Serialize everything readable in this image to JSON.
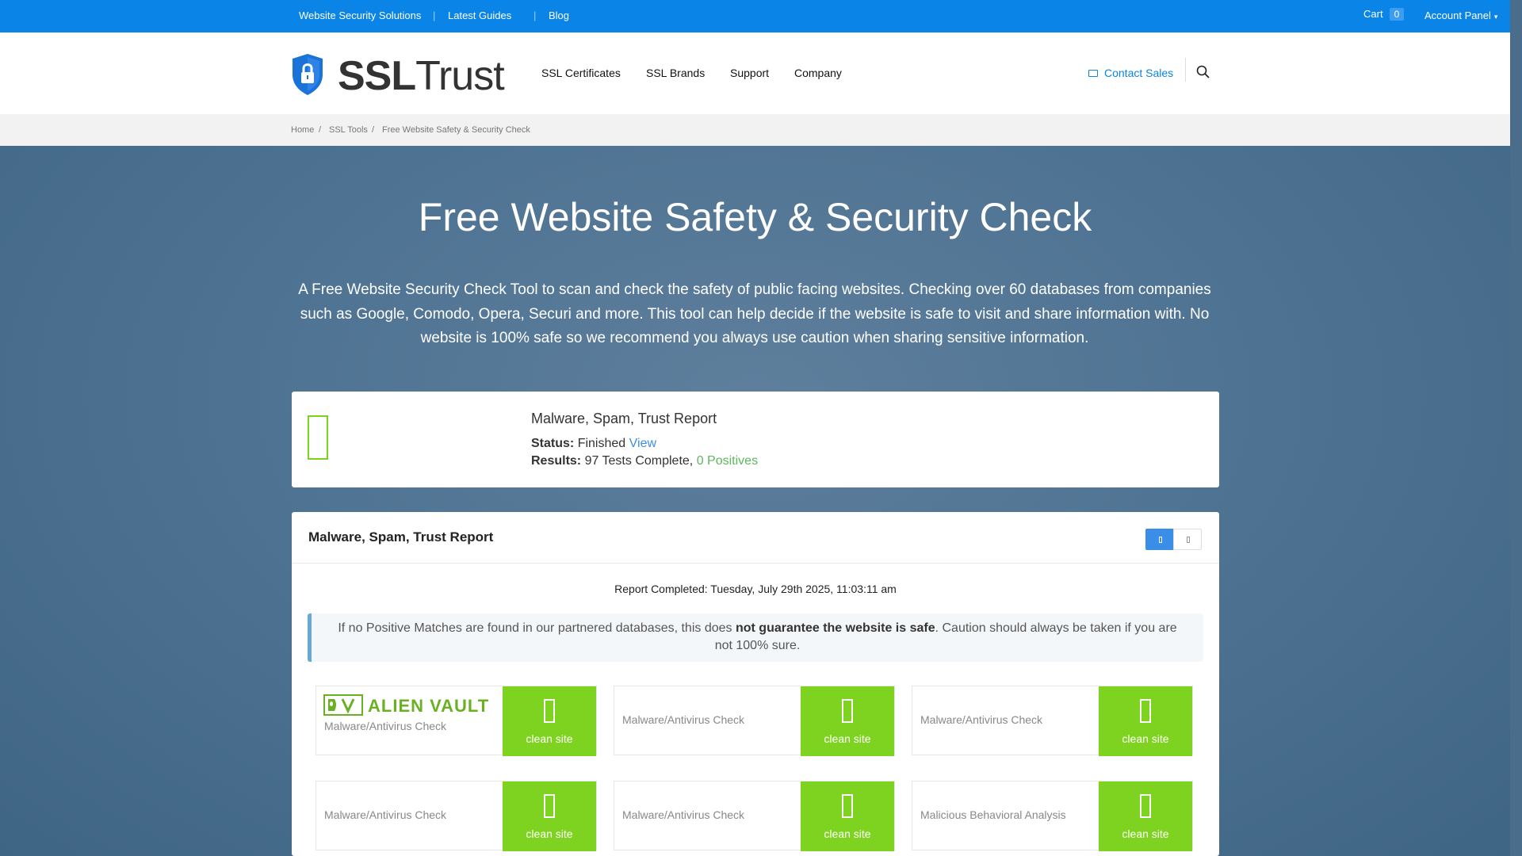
{
  "topbar": {
    "links": [
      "Website Security Solutions",
      "Latest Guides",
      "Blog"
    ],
    "cart_label": "Cart",
    "cart_count": "0",
    "account_label": "Account Panel"
  },
  "header": {
    "logo_text": "SSLTrust",
    "nav": [
      "SSL Certificates",
      "SSL Brands",
      "Support",
      "Company"
    ],
    "contact_label": "Contact Sales"
  },
  "breadcrumb": [
    "Home",
    "SSL Tools",
    "Free Website Safety & Security Check"
  ],
  "hero": {
    "title": "Free Website Safety & Security Check",
    "text": "A Free Website Security Check Tool to scan and check the safety of public facing websites. Checking over 60 databases from companies such as Google, Comodo, Opera, Securi and more. This tool can help decide if the website is safe to visit and share information with. No website is 100% safe so we recommend you always use caution when sharing sensitive information."
  },
  "summary": {
    "title": "Malware, Spam, Trust Report",
    "status_label": "Status:",
    "status_value": "Finished",
    "status_link": "View",
    "results_label": "Results:",
    "results_value": "97 Tests Complete,",
    "results_link": "0 Positives"
  },
  "report": {
    "title": "Malware, Spam, Trust Report",
    "completed": "Report Completed: Tuesday, July 29th 2025, 11:03:11 am",
    "notice_pre": "If no Positive Matches are found in our partnered databases, this does ",
    "notice_bold": "not guarantee the website is safe",
    "notice_post": ". Caution should always be taken if you are not 100% sure.",
    "results": [
      {
        "vendor_logo": "ALIEN VAULT",
        "label": "Malware/Antivirus Check",
        "status": "clean site"
      },
      {
        "label": "Malware/Antivirus Check",
        "status": "clean site"
      },
      {
        "label": "Malware/Antivirus Check",
        "status": "clean site"
      },
      {
        "label": "Malware/Antivirus Check",
        "status": "clean site"
      },
      {
        "label": "Malware/Antivirus Check",
        "status": "clean site"
      },
      {
        "label": "Malicious Behavioral Analysis",
        "status": "clean site"
      }
    ]
  },
  "colors": {
    "topbar": "#0a84e6",
    "clean": "#7ed321",
    "link": "#3b8ee8",
    "positives": "#5cb85c"
  }
}
